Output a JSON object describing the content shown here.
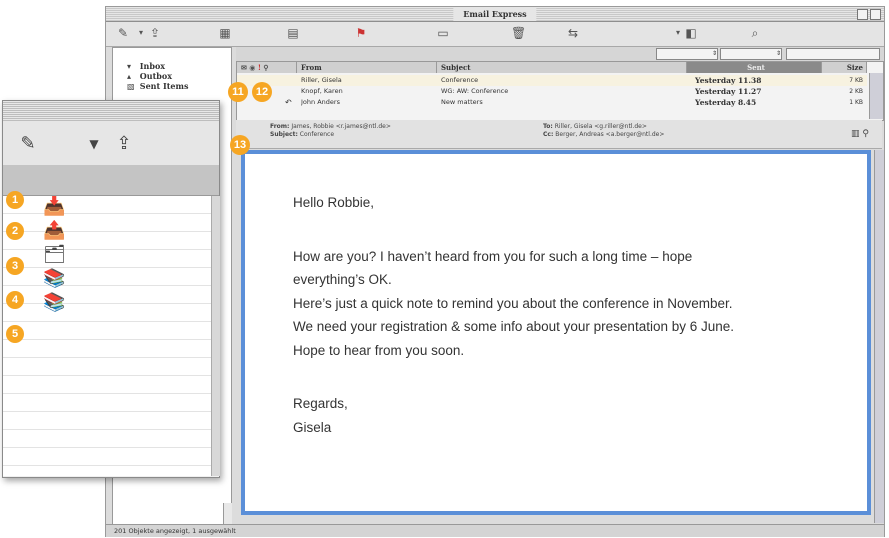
{
  "window": {
    "title": "Email Express"
  },
  "folders": [
    {
      "label": "Inbox",
      "icon": "inbox-icon"
    },
    {
      "label": "Outbox",
      "icon": "outbox-icon"
    },
    {
      "label": "Sent Items",
      "icon": "sent-items-icon"
    }
  ],
  "message_list": {
    "columns": {
      "from": "From",
      "subject": "Subject",
      "sent": "Sent",
      "size": "Size"
    },
    "rows": [
      {
        "from": "Riller, Gisela",
        "subject": "Conference",
        "sent": "Yesterday 11.38",
        "size": "7 KB"
      },
      {
        "from": "Knopf, Karen",
        "subject": "WG: AW: Conference",
        "sent": "Yesterday 11.27",
        "size": "2 KB"
      },
      {
        "from": "John Anders",
        "subject": "New matters",
        "sent": "Yesterday 8.45",
        "size": "1 KB"
      }
    ]
  },
  "preview": {
    "from_label": "From:",
    "from_value": "James, Robbie <r.james@ntl.de>",
    "subject_label": "Subject:",
    "subject_value": "Conference",
    "to_label": "To:",
    "to_value": "Riller, Gisela <g.riller@ntl.de>",
    "cc_label": "Cc:",
    "cc_value": "Berger, Andreas <a.berger@ntl.de>"
  },
  "body_lines": [
    "Hello Robbie,",
    "How are you? I haven’t heard from you for such a long time – hope",
    "everything’s OK.",
    "Here’s just a quick note to remind you about the conference in November.",
    "We need your registration & some info about your presentation by 6 June.",
    "Hope to hear from you soon.",
    "Regards,",
    "Gisela"
  ],
  "status": "201 Objekte angezeigt, 1 ausgewählt",
  "callouts": [
    "1",
    "2",
    "3",
    "4",
    "5",
    "11",
    "12",
    "13"
  ],
  "colors": {
    "accent": "#5b8fd8",
    "callout": "#f6a623"
  }
}
